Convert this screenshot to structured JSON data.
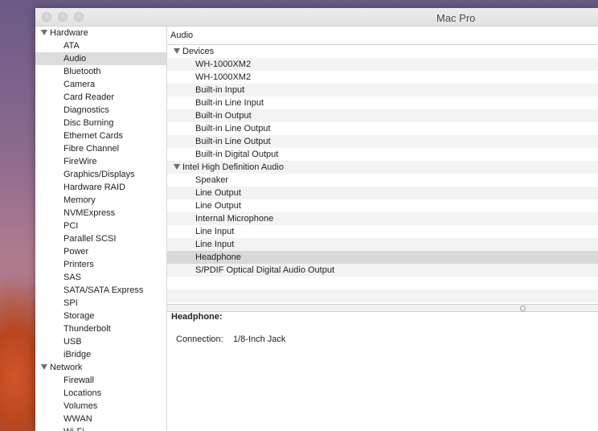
{
  "window": {
    "title": "Mac Pro"
  },
  "sidebar": {
    "groups": [
      {
        "label": "Hardware",
        "items": [
          "ATA",
          "Audio",
          "Bluetooth",
          "Camera",
          "Card Reader",
          "Diagnostics",
          "Disc Burning",
          "Ethernet Cards",
          "Fibre Channel",
          "FireWire",
          "Graphics/Displays",
          "Hardware RAID",
          "Memory",
          "NVMExpress",
          "PCI",
          "Parallel SCSI",
          "Power",
          "Printers",
          "SAS",
          "SATA/SATA Express",
          "SPI",
          "Storage",
          "Thunderbolt",
          "USB",
          "iBridge"
        ]
      },
      {
        "label": "Network",
        "items": [
          "Firewall",
          "Locations",
          "Volumes",
          "WWAN",
          "Wi-Fi"
        ]
      }
    ],
    "selected": "Audio"
  },
  "main": {
    "header": "Audio",
    "tree": [
      {
        "label": "Devices",
        "children": [
          "WH-1000XM2",
          "WH-1000XM2",
          "Built-in Input",
          "Built-in Line Input",
          "Built-in Output",
          "Built-in Line Output",
          "Built-in Line Output",
          "Built-in Digital Output"
        ]
      },
      {
        "label": "Intel High Definition Audio",
        "children": [
          "Speaker",
          "Line Output",
          "Line Output",
          "Internal Microphone",
          "Line Input",
          "Line Input",
          "Headphone",
          "S/PDIF Optical Digital Audio Output"
        ]
      }
    ],
    "selected_item": "Headphone"
  },
  "detail": {
    "title": "Headphone:",
    "connection_label": "Connection:",
    "connection_value": "1/8-Inch Jack"
  }
}
